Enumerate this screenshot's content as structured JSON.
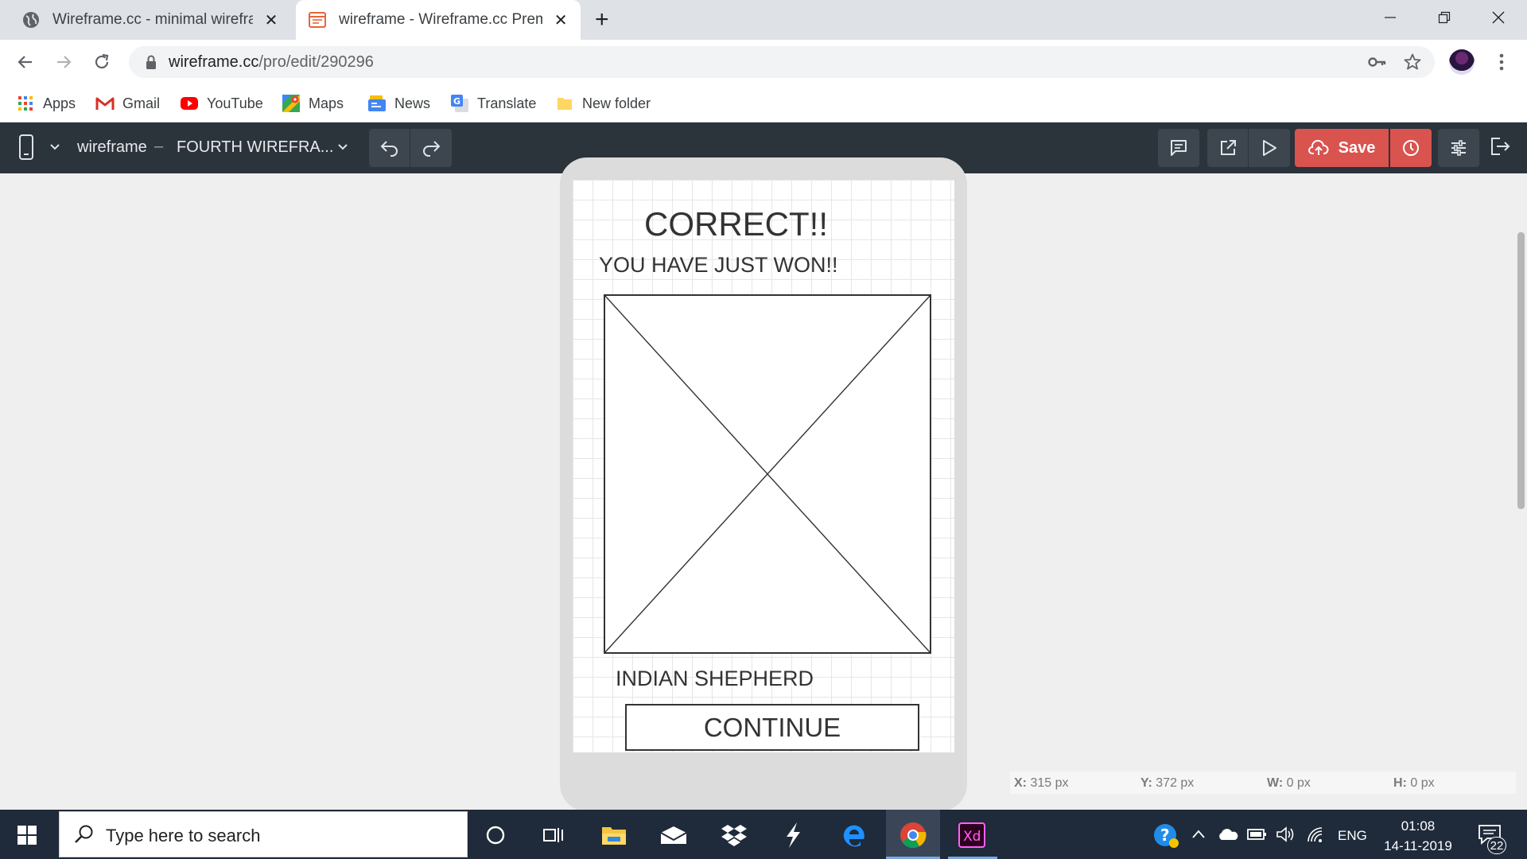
{
  "browser": {
    "tabs": [
      {
        "title": "Wireframe.cc - minimal wireframing tool",
        "active": false
      },
      {
        "title": "wireframe - Wireframe.cc Premium",
        "active": true
      }
    ],
    "url_domain": "wireframe.cc",
    "url_path": "/pro/edit/290296",
    "bookmarks": [
      {
        "label": "Apps",
        "icon": "apps-grid-icon"
      },
      {
        "label": "Gmail",
        "icon": "gmail-icon"
      },
      {
        "label": "YouTube",
        "icon": "youtube-icon"
      },
      {
        "label": "Maps",
        "icon": "maps-icon"
      },
      {
        "label": "News",
        "icon": "news-icon"
      },
      {
        "label": "Translate",
        "icon": "translate-icon"
      },
      {
        "label": "New folder",
        "icon": "folder-icon"
      }
    ]
  },
  "app": {
    "project_name": "wireframe",
    "separator": "–",
    "page_name": "FOURTH WIREFRA...",
    "save_label": "Save",
    "colors": {
      "header": "#2b333b",
      "save": "#d9534f"
    }
  },
  "wireframe": {
    "title": "CORRECT!!",
    "subtitle": "YOU HAVE JUST WON!!",
    "image_caption": "INDIAN SHEPHERD",
    "button_label": "CONTINUE"
  },
  "status": {
    "x_label": "X:",
    "x_value": "315 px",
    "y_label": "Y:",
    "y_value": "372 px",
    "w_label": "W:",
    "w_value": "0 px",
    "h_label": "H:",
    "h_value": "0 px"
  },
  "taskbar": {
    "search_placeholder": "Type here to search",
    "language": "ENG",
    "time": "01:08",
    "date": "14-11-2019",
    "notifications": "22"
  }
}
